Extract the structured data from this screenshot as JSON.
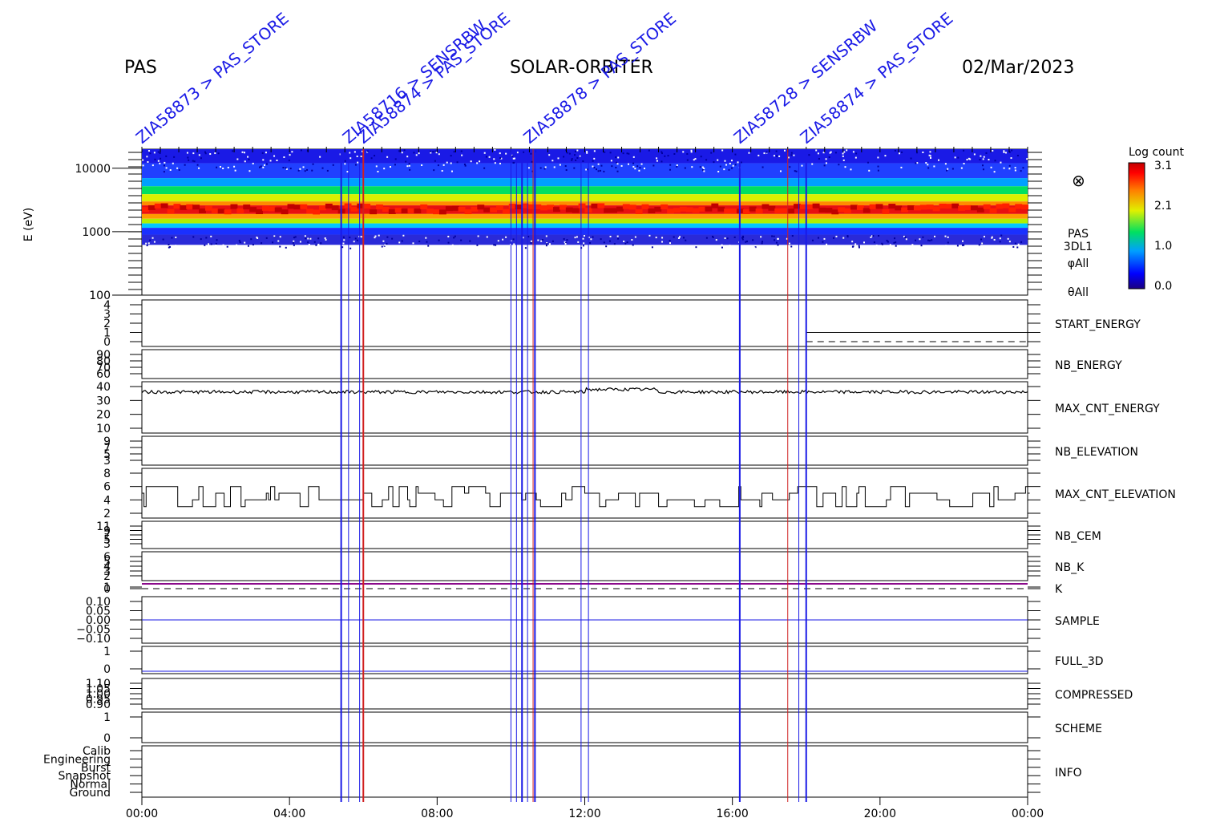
{
  "header": {
    "left": "PAS",
    "center": "SOLAR-ORBITER",
    "right": "02/Mar/2023"
  },
  "colorbar": {
    "title": "Log count",
    "ticks": [
      "3.1",
      "2.1",
      "1.0",
      "0.0"
    ]
  },
  "spectrogram": {
    "ylabel": "E (eV)",
    "yticks": [
      "10000",
      "1000",
      "100"
    ],
    "side_labels": [
      "PAS",
      "3DL1",
      "φAll",
      "θAll"
    ],
    "symbol": "⊗"
  },
  "panels": [
    {
      "label": "START_ENERGY",
      "color": "#000000",
      "yticks": [
        "4",
        "3",
        "2",
        "1",
        "0"
      ]
    },
    {
      "label": "NB_ENERGY",
      "color": "#1a1ae6",
      "yticks": [
        "90",
        "80",
        "70",
        "60"
      ]
    },
    {
      "label": "MAX_CNT_ENERGY",
      "color": "#000000",
      "yticks": [
        "40",
        "30",
        "20",
        "10"
      ]
    },
    {
      "label": "NB_ELEVATION",
      "color": "#1a1ae6",
      "yticks": [
        "9",
        "7",
        "5",
        "3"
      ]
    },
    {
      "label": "MAX_CNT_ELEVATION",
      "color": "#000000",
      "yticks": [
        "8",
        "6",
        "4",
        "2"
      ]
    },
    {
      "label": "NB_CEM",
      "color": "#1a1ae6",
      "yticks": [
        "11",
        "9",
        "7",
        "5",
        "3"
      ]
    },
    {
      "label": "NB_K",
      "color": "#e61a1a",
      "yticks": [
        "6",
        "5",
        "4",
        "3",
        "2"
      ]
    },
    {
      "label": "K",
      "color": "#1a1ae6",
      "yticks": [
        "1",
        "0"
      ]
    },
    {
      "label": "SAMPLE",
      "color": "#1a1ae6",
      "yticks": [
        "0.10",
        "0.05",
        "0.00",
        "−0.05",
        "−0.10"
      ]
    },
    {
      "label": "FULL_3D",
      "color": "#1a1ae6",
      "yticks": [
        "1",
        "0"
      ]
    },
    {
      "label": "COMPRESSED",
      "color": "#000000",
      "yticks": [
        "1.10",
        "1.05",
        "1.00",
        "0.95",
        "0.90"
      ]
    },
    {
      "label": "SCHEME",
      "color": "#000000",
      "yticks": [
        "1",
        "0"
      ]
    },
    {
      "label": "INFO",
      "color": "#000000",
      "yticks": [
        "Calib",
        "Engineering",
        "Burst",
        "Snapshot",
        "Normal",
        "Ground"
      ]
    }
  ],
  "chart_data": {
    "type": "heatmap",
    "title": "SOLAR-ORBITER",
    "xlabel": "",
    "ylabel": "E (eV)",
    "x_ticks": [
      "00:00",
      "04:00",
      "08:00",
      "12:00",
      "16:00",
      "20:00",
      "00:00"
    ],
    "x_range_hours": [
      0,
      24
    ],
    "y_range_eV": [
      100,
      20000
    ],
    "y_scale": "log",
    "colorbar_range": [
      0.0,
      3.1
    ],
    "event_lines_hours": [
      5.4,
      5.6,
      5.9,
      6.0,
      10.0,
      10.15,
      10.3,
      10.45,
      10.6,
      10.65,
      11.9,
      12.1,
      16.2,
      17.5,
      17.8,
      18.0
    ],
    "event_labels": [
      "ZIA58873 > PAS_STORE",
      "ZIA58716 > SENSRBW",
      "ZIA58874 > PAS_STORE",
      "ZIA58878 > PAS_STORE",
      "ZIA58728 > SENSRBW",
      "ZIA58874 > PAS_STORE"
    ],
    "peak_energy_eV": 2200,
    "max_cnt_energy_mean": 37,
    "max_cnt_elevation_levels": [
      3,
      4,
      5,
      6
    ]
  }
}
